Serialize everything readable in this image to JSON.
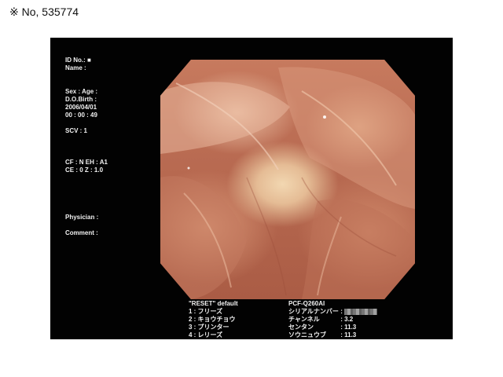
{
  "caption": {
    "mark": "※",
    "number": "No, 535774"
  },
  "osd": {
    "id_label": "ID No.:",
    "id_value": "■",
    "name_label": "Name :",
    "sex_age_label": "Sex :    Age :",
    "birth_label": "D.O.Birth :",
    "date": "2006/04/01",
    "time": "00 : 00 : 49",
    "scv": "SCV : 1",
    "ce_row": "CF : N  EH : A1",
    "cf_row": "CE : 0  Z : 1.0",
    "physician_label": "Physician :",
    "comment_label": "Comment :"
  },
  "presets": {
    "title": "\"RESET\" default",
    "items": [
      "1 : フリーズ",
      "2 : キョウチョウ",
      "3 : プリンター",
      "4 : レリーズ"
    ]
  },
  "scope": {
    "model": "PCF-Q260AI",
    "specs": [
      {
        "key": "シリアルナンバー",
        "value": ":"
      },
      {
        "key": "チャンネル",
        "value": ": 3.2"
      },
      {
        "key": "センタン",
        "value": ": 11.3"
      },
      {
        "key": "ソウニュウブ",
        "value": ": 11.3"
      }
    ]
  },
  "colors": {
    "background": "#ffffff",
    "monitor": "#020202",
    "osd_text": "#f2f2f2"
  }
}
